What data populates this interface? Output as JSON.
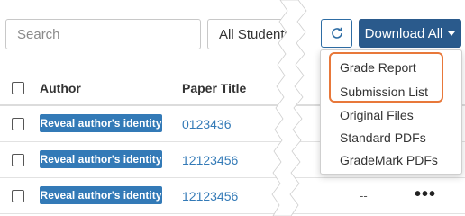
{
  "search": {
    "placeholder": "Search"
  },
  "filter": {
    "selected": "All Students"
  },
  "toolbar": {
    "refresh_icon": "refresh-icon",
    "download_label": "Download All",
    "download_caret_icon": "caret-down-icon"
  },
  "table": {
    "headers": {
      "author": "Author",
      "paper_title": "Paper Title"
    },
    "rows": [
      {
        "reveal_label": "Reveal author's identity",
        "paper_title": "0123436",
        "extra": "",
        "more": ""
      },
      {
        "reveal_label": "Reveal author's identity",
        "paper_title": "12123456",
        "extra": "",
        "more": ""
      },
      {
        "reveal_label": "Reveal author's identity",
        "paper_title": "12123456",
        "extra": "--",
        "more": "•••"
      }
    ]
  },
  "dropdown": {
    "items": [
      "Grade Report",
      "Submission List",
      "Original Files",
      "Standard PDFs",
      "GradeMark PDFs"
    ],
    "highlighted_items": [
      "Grade Report",
      "Submission List"
    ],
    "highlight_color": "#e8783a"
  },
  "colors": {
    "primary_button": "#2a5a8c",
    "reveal_badge": "#337ab7",
    "link": "#337ab7"
  }
}
